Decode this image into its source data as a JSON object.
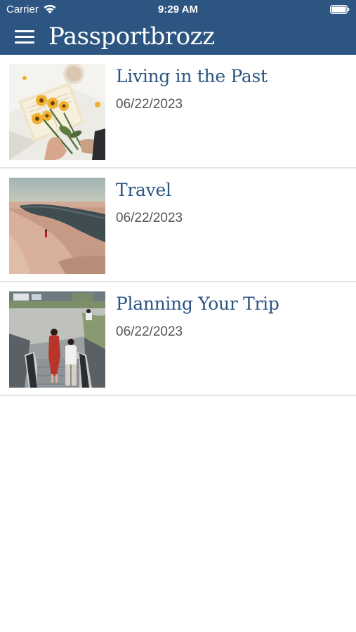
{
  "status_bar": {
    "carrier": "Carrier",
    "time": "9:29 AM",
    "icons": [
      "wifi-icon",
      "battery-icon"
    ]
  },
  "header": {
    "title": "Passportbrozz",
    "menu_icon": "hamburger-menu-icon",
    "background_color": "#2c5582"
  },
  "posts": [
    {
      "title": "Living in the Past",
      "date": "06/22/2023",
      "thumbnail": "sunflowers-and-book-photo"
    },
    {
      "title": "Travel",
      "date": "06/22/2023",
      "thumbnail": "desert-lagoon-photo"
    },
    {
      "title": "Planning Your Trip",
      "date": "06/22/2023",
      "thumbnail": "escalator-walkers-photo"
    }
  ],
  "colors": {
    "title_text": "#2c5582",
    "date_text": "#555555",
    "divider": "#e2e4e7"
  }
}
